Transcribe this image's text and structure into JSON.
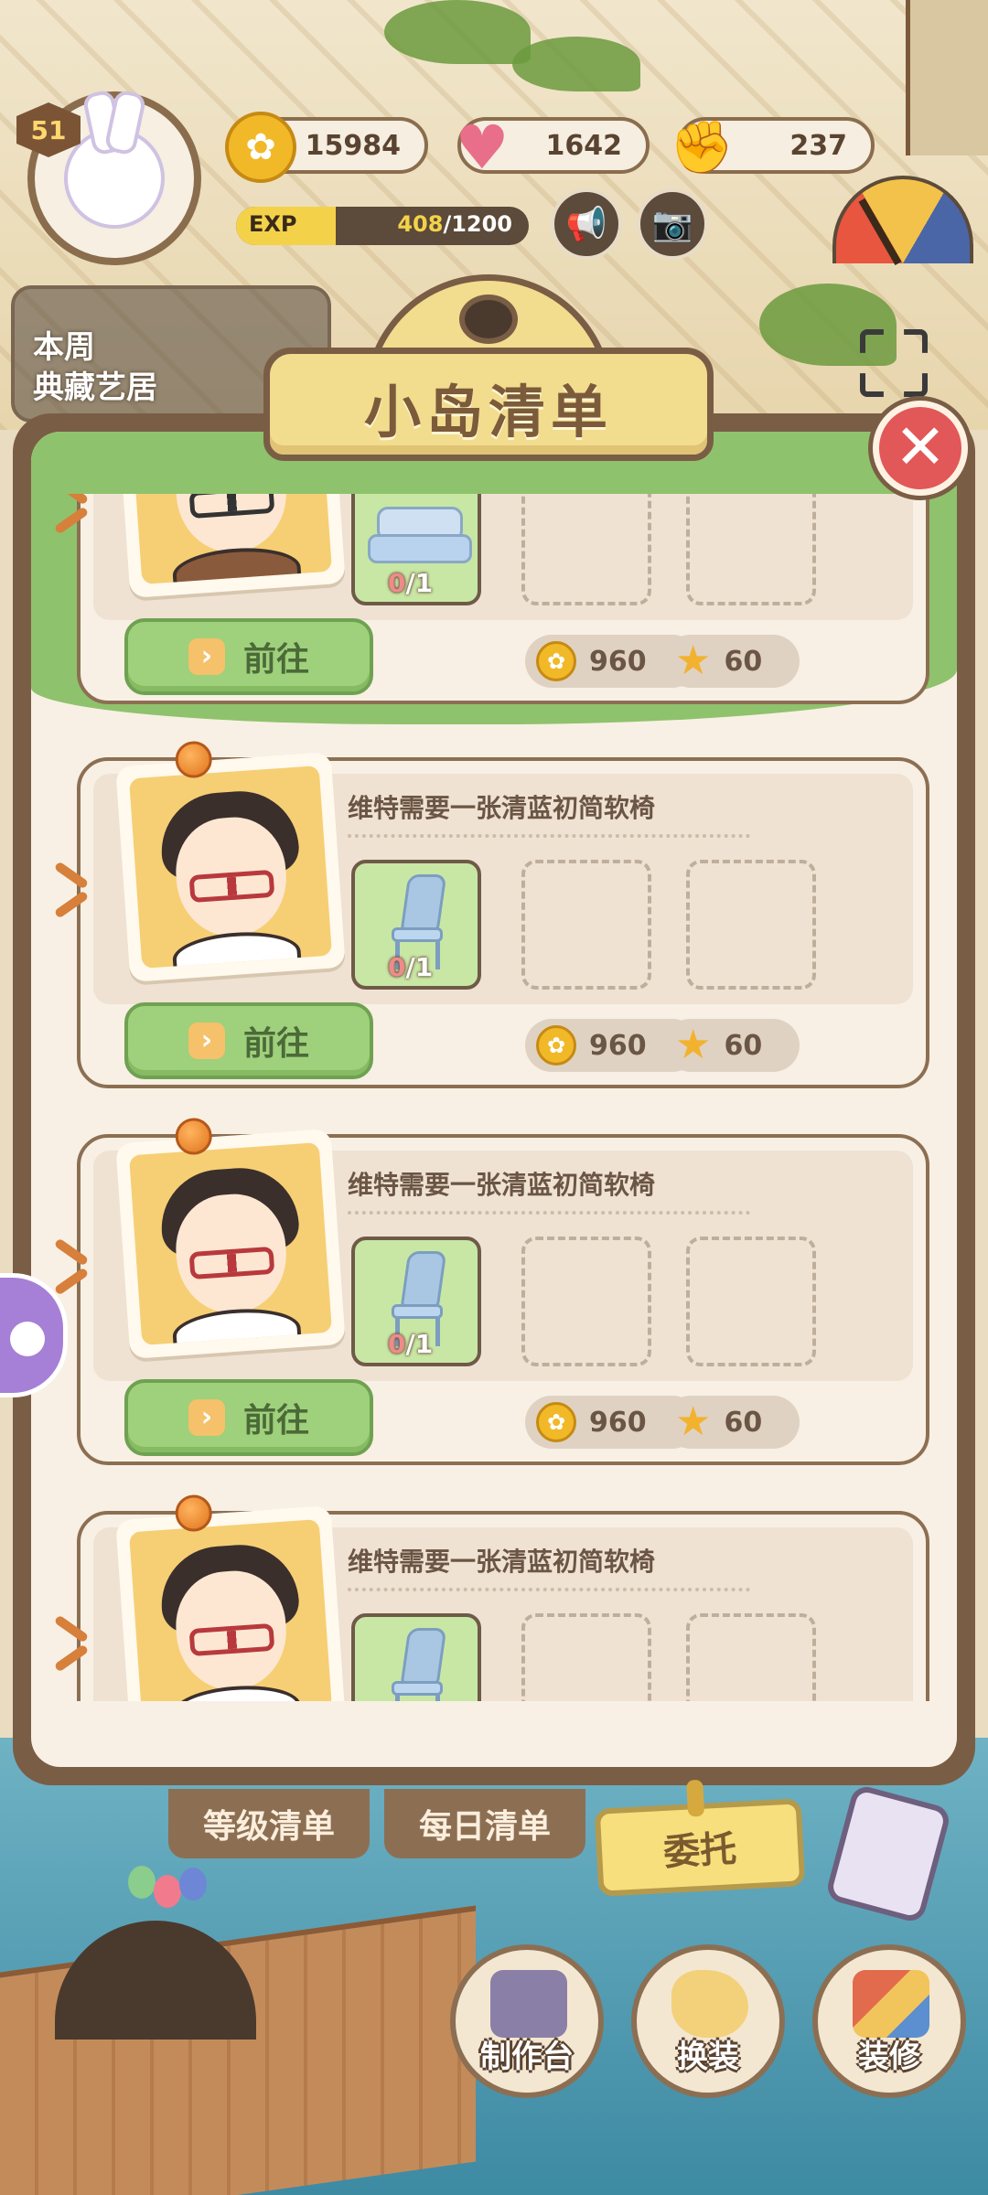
{
  "hud": {
    "level": "51",
    "currencies": {
      "coins": "15984",
      "hearts": "1642",
      "gloves": "237"
    },
    "exp": {
      "label": "EXP",
      "current": "408",
      "separator": "/",
      "max": "1200",
      "progress": 0.34
    },
    "weekly_banner": {
      "line1": "本周",
      "line2": "典藏艺居"
    }
  },
  "modal": {
    "title": "小岛清单",
    "close_label": "✕",
    "cards": [
      {
        "description": "",
        "item": "sofa",
        "progress_have": "0",
        "progress_sep": "/",
        "progress_need": "1",
        "goto_label": "前往",
        "reward_coins": "960",
        "reward_stars": "60"
      },
      {
        "description": "维特需要一张清蓝初简软椅",
        "item": "chair",
        "progress_have": "0",
        "progress_sep": "/",
        "progress_need": "1",
        "goto_label": "前往",
        "reward_coins": "960",
        "reward_stars": "60"
      },
      {
        "description": "维特需要一张清蓝初简软椅",
        "item": "chair",
        "progress_have": "0",
        "progress_sep": "/",
        "progress_need": "1",
        "goto_label": "前往",
        "reward_coins": "960",
        "reward_stars": "60"
      },
      {
        "description": "维特需要一张清蓝初简软椅",
        "item": "chair",
        "progress_have": "",
        "progress_sep": "",
        "progress_need": "",
        "goto_label": "",
        "reward_coins": "",
        "reward_stars": ""
      }
    ]
  },
  "tabs": {
    "level_list": "等级清单",
    "daily_list": "每日清单",
    "commission": "委托"
  },
  "actions": {
    "workbench": "制作台",
    "dress_up": "换装",
    "decorate": "装修"
  },
  "colors": {
    "frame_brown": "#7a5d45",
    "header_green": "#8fc26c",
    "goto_green": "#9fd07c",
    "close_red": "#e25757",
    "title_gold": "#f2dc8e"
  }
}
